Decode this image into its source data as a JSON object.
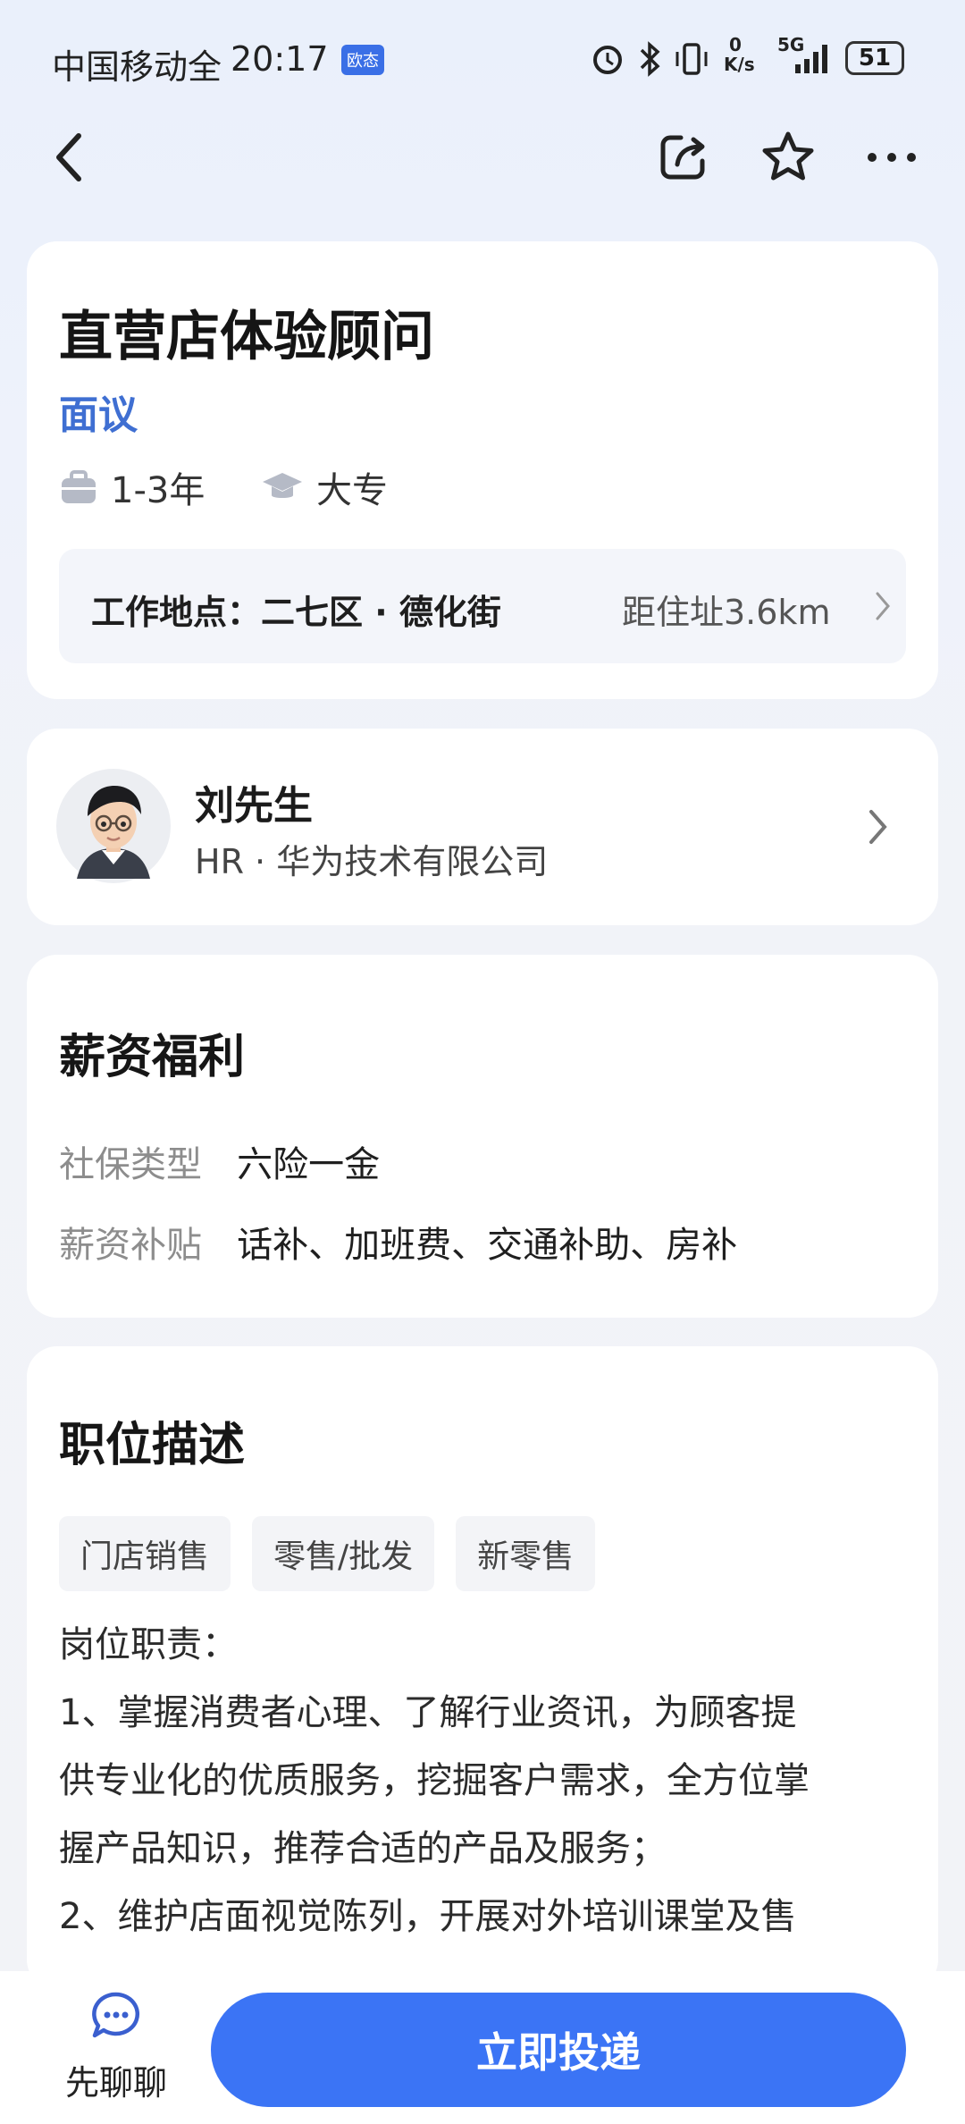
{
  "status_bar": {
    "carrier": "中国移动全",
    "time": "20:17",
    "chip": "欧态",
    "net_speed_top": "0",
    "net_speed_unit": "K/s",
    "network": "5G",
    "battery": "51"
  },
  "job": {
    "title": "直营店体验顾问",
    "salary": "面议",
    "experience": "1-3年",
    "education": "大专",
    "location_label": "工作地点：二七区 · 德化街",
    "distance": "距住址3.6km"
  },
  "recruiter": {
    "name": "刘先生",
    "company": "HR · 华为技术有限公司"
  },
  "benefits": {
    "title": "薪资福利",
    "rows": [
      {
        "label": "社保类型",
        "value": "六险一金"
      },
      {
        "label": "薪资补贴",
        "value": "话补、加班费、交通补助、房补"
      }
    ]
  },
  "description": {
    "title": "职位描述",
    "tags": [
      "门店销售",
      "零售/批发",
      "新零售"
    ],
    "lines": [
      "岗位职责：",
      "1、掌握消费者心理、了解行业资讯，为顾客提",
      "供专业化的优质服务，挖掘客户需求，全方位掌",
      "握产品知识，推荐合适的产品及服务；",
      "2、维护店面视觉陈列，开展对外培训课堂及售"
    ]
  },
  "bottom": {
    "chat_label": "先聊聊",
    "apply_label": "立即投递"
  },
  "colors": {
    "accent": "#3b74f5",
    "salary": "#3f6fd2"
  }
}
